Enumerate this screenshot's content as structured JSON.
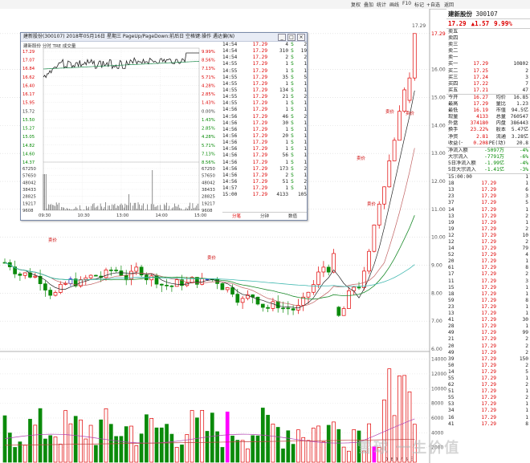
{
  "toolbar": {
    "buttons": [
      "复权",
      "叠加",
      "统计",
      "画线",
      "F10",
      "标记",
      "+自选",
      "返回"
    ]
  },
  "stock": {
    "name": "建新股份",
    "code": "300107",
    "price": "17.29",
    "change": "▲1.57",
    "pct": "9.99%"
  },
  "order_book": [
    {
      "label": "卖五",
      "price": "",
      "vol": ""
    },
    {
      "label": "卖四",
      "price": "",
      "vol": ""
    },
    {
      "label": "卖三",
      "price": "",
      "vol": ""
    },
    {
      "label": "卖二",
      "price": "",
      "vol": ""
    },
    {
      "label": "卖一",
      "price": "",
      "vol": ""
    },
    {
      "label": "买一",
      "price": "17.29",
      "vol": "10802"
    },
    {
      "label": "买二",
      "price": "17.25",
      "vol": "2"
    },
    {
      "label": "买三",
      "price": "17.24",
      "vol": "3"
    },
    {
      "label": "买四",
      "price": "17.22",
      "vol": "7"
    },
    {
      "label": "买五",
      "price": "17.21",
      "vol": "47"
    }
  ],
  "stats": [
    {
      "k1": "今开",
      "v1": "16.27",
      "k2": "均价",
      "v2": "16.85"
    },
    {
      "k1": "最高",
      "v1": "17.29",
      "k2": "量比",
      "v2": "1.23"
    },
    {
      "k1": "最低",
      "v1": "16.19",
      "k2": "市值",
      "v2": "94.5亿"
    },
    {
      "k1": "现量",
      "v1": "4133",
      "k2": "总量",
      "v2": "760547"
    },
    {
      "k1": "外盘",
      "v1": "374180",
      "k2": "内盘",
      "v2": "386443"
    },
    {
      "k1": "换手",
      "v1": "23.22%",
      "k2": "股本",
      "v2": "5.47亿"
    },
    {
      "k1": "净资",
      "v1": "2.81",
      "k2": "流通",
      "v2": "3.28亿"
    },
    {
      "k1": "收益(一)",
      "v1": "0.208",
      "k2": "PE(动)",
      "v2": "20.8"
    }
  ],
  "flows": [
    {
      "label": "净流入额",
      "value": "-5097万",
      "pct": "-4%"
    },
    {
      "label": "大宗流入",
      "value": "-7791万",
      "pct": "-6%"
    },
    {
      "label": "5日净流入额",
      "value": "-1.99亿",
      "pct": "-4%"
    },
    {
      "label": "5日大宗流入",
      "value": "-1.41亿",
      "pct": "-3%"
    }
  ],
  "right_ticks": [
    {
      "t": "15:00:00",
      "p": "",
      "v": "1"
    },
    {
      "t": "18",
      "p": "17.29",
      "v": "1"
    },
    {
      "t": "13",
      "p": "17.29",
      "v": "6"
    },
    {
      "t": "23",
      "p": "17.29",
      "v": "3"
    },
    {
      "t": "37",
      "p": "17.29",
      "v": "5"
    },
    {
      "t": "14",
      "p": "17.29",
      "v": "1"
    },
    {
      "t": "13",
      "p": "17.29",
      "v": "2"
    },
    {
      "t": "19",
      "p": "17.29",
      "v": "1"
    },
    {
      "t": "19",
      "p": "17.29",
      "v": "2"
    },
    {
      "t": "12",
      "p": "17.29",
      "v": "10"
    },
    {
      "t": "12",
      "p": "17.29",
      "v": "2"
    },
    {
      "t": "14",
      "p": "17.29",
      "v": "79"
    },
    {
      "t": "52",
      "p": "17.29",
      "v": "4"
    },
    {
      "t": "20",
      "p": "17.29",
      "v": "1"
    },
    {
      "t": "61",
      "p": "17.29",
      "v": "8"
    },
    {
      "t": "17",
      "p": "17.29",
      "v": "2"
    },
    {
      "t": "11",
      "p": "17.29",
      "v": "3"
    },
    {
      "t": "15",
      "p": "17.29",
      "v": "1"
    },
    {
      "t": "18",
      "p": "17.29",
      "v": "1"
    },
    {
      "t": "59",
      "p": "17.29",
      "v": "8"
    },
    {
      "t": "23",
      "p": "17.29",
      "v": "1"
    },
    {
      "t": "13",
      "p": "17.29",
      "v": "1"
    },
    {
      "t": "41",
      "p": "17.29",
      "v": "30"
    },
    {
      "t": "28",
      "p": "17.29",
      "v": "1"
    },
    {
      "t": "49",
      "p": "17.29",
      "v": "99"
    },
    {
      "t": "21",
      "p": "17.29",
      "v": "2"
    },
    {
      "t": "20",
      "p": "17.29",
      "v": "2"
    },
    {
      "t": "49",
      "p": "17.29",
      "v": "2"
    },
    {
      "t": "39",
      "p": "17.29",
      "v": "150"
    },
    {
      "t": "50",
      "p": "17.29",
      "v": "2"
    },
    {
      "t": "14",
      "p": "17.29",
      "v": "5"
    },
    {
      "t": "55",
      "p": "17.29",
      "v": "1"
    },
    {
      "t": "62",
      "p": "17.29",
      "v": "2"
    },
    {
      "t": "51",
      "p": "17.29",
      "v": "1"
    },
    {
      "t": "55",
      "p": "17.29",
      "v": "2"
    },
    {
      "t": "53",
      "p": "17.29",
      "v": "1"
    },
    {
      "t": "34",
      "p": "17.29",
      "v": "1"
    },
    {
      "t": "16",
      "p": "17.29",
      "v": "1"
    },
    {
      "t": "41",
      "p": "17.29",
      "v": "8"
    }
  ],
  "minute_window": {
    "title": "建新股份(300107) 2018年05月16日 星期三 PageUp/PageDown:前后日 空格键:操作 遇达偏(N)",
    "legend": "建新股份  分时  TRE  成交量",
    "price_labels": [
      "17.29",
      "17.07",
      "16.84",
      "16.62",
      "16.40",
      "16.17",
      "15.95",
      "15.72",
      "15.50",
      "15.27",
      "15.05",
      "14.82",
      "14.60",
      "14.37",
      "67250",
      "57650",
      "48042",
      "38433",
      "28825",
      "19217",
      "9608"
    ],
    "pct_labels": [
      "9.99%",
      "8.56%",
      "7.13%",
      "5.71%",
      "4.28%",
      "2.85%",
      "1.43%",
      "0.00%",
      "1.43%",
      "2.85%",
      "4.28%",
      "5.71%",
      "7.13%",
      "8.56%",
      "67250",
      "57650",
      "48042",
      "38433",
      "28825",
      "19217",
      "9608"
    ],
    "time_labels": [
      "09:30",
      "10:30",
      "13:00",
      "14:00",
      "15:00"
    ],
    "ticks": [
      {
        "t": "14:54",
        "p": "17.29",
        "v": "4",
        "d": "S",
        "n": "2"
      },
      {
        "t": "14:54",
        "p": "17.29",
        "v": "310",
        "d": "S",
        "n": "19"
      },
      {
        "t": "14:54",
        "p": "17.29",
        "v": "2",
        "d": "S",
        "n": "2"
      },
      {
        "t": "14:55",
        "p": "17.29",
        "v": "1",
        "d": "S",
        "n": "1"
      },
      {
        "t": "14:55",
        "p": "17.29",
        "v": "1",
        "d": "S",
        "n": "1"
      },
      {
        "t": "14:55",
        "p": "17.29",
        "v": "35",
        "d": "S",
        "n": "5"
      },
      {
        "t": "14:55",
        "p": "17.29",
        "v": "1",
        "d": "S",
        "n": "1"
      },
      {
        "t": "14:55",
        "p": "17.29",
        "v": "134",
        "d": "S",
        "n": "1"
      },
      {
        "t": "14:55",
        "p": "17.29",
        "v": "21",
        "d": "S",
        "n": "2"
      },
      {
        "t": "14:55",
        "p": "17.29",
        "v": "1",
        "d": "S",
        "n": "1"
      },
      {
        "t": "14:56",
        "p": "17.29",
        "v": "1",
        "d": "S",
        "n": "1"
      },
      {
        "t": "14:56",
        "p": "17.29",
        "v": "46",
        "d": "S",
        "n": "2"
      },
      {
        "t": "14:56",
        "p": "17.29",
        "v": "30",
        "d": "S",
        "n": "1"
      },
      {
        "t": "14:56",
        "p": "17.29",
        "v": "1",
        "d": "S",
        "n": "1"
      },
      {
        "t": "14:56",
        "p": "17.29",
        "v": "20",
        "d": "S",
        "n": "1"
      },
      {
        "t": "14:56",
        "p": "17.29",
        "v": "1",
        "d": "S",
        "n": "1"
      },
      {
        "t": "14:56",
        "p": "17.29",
        "v": "1",
        "d": "S",
        "n": "1"
      },
      {
        "t": "14:56",
        "p": "17.29",
        "v": "56",
        "d": "S",
        "n": "1"
      },
      {
        "t": "14:56",
        "p": "17.29",
        "v": "1",
        "d": "S",
        "n": "1"
      },
      {
        "t": "14:56",
        "p": "17.29",
        "v": "173",
        "d": "S",
        "n": "2"
      },
      {
        "t": "14:56",
        "p": "17.29",
        "v": "2",
        "d": "S",
        "n": "1"
      },
      {
        "t": "14:56",
        "p": "17.29",
        "v": "51",
        "d": "S",
        "n": "2"
      },
      {
        "t": "14:57",
        "p": "17.29",
        "v": "1",
        "d": "S",
        "n": "1"
      },
      {
        "t": "15:00",
        "p": "17.29",
        "v": "4133",
        "d": "",
        "n": "105"
      }
    ],
    "tabs": [
      "分笔",
      "分钟",
      "数值"
    ]
  },
  "kline": {
    "price_axis": [
      "17.29",
      "16.00",
      "15.00",
      "14.00",
      "13.00",
      "12.00",
      "11.00",
      "10.00",
      "9.00",
      "8.00",
      "7.00",
      "6.00"
    ],
    "vol_axis": [
      "14000",
      "12000",
      "10000",
      "8000",
      "6000",
      "4000",
      "2000"
    ],
    "top_price": "17.29",
    "date_label": "2018/05/16/三",
    "x_labels": [
      "3",
      "4",
      "5"
    ],
    "markers": [
      "卖价",
      "卖价",
      "卖价",
      "卖价",
      "卖价",
      "卖价"
    ]
  },
  "watermark": "雪球 一生价值",
  "colors": {
    "up": "#e00000",
    "down": "#0a8a0a",
    "blue": "#1010c0",
    "ma_red": "#c06060",
    "ma_green": "#1a8a2a",
    "ma_teal": "#40b8b0",
    "magenta": "#ff00ff"
  }
}
